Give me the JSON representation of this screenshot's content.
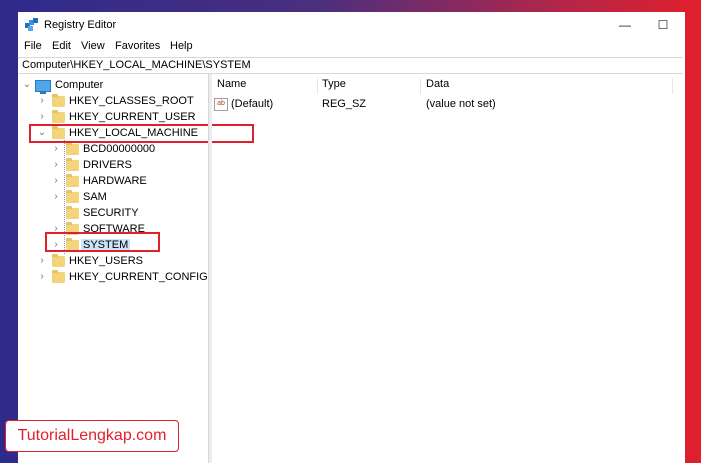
{
  "window": {
    "title": "Registry Editor",
    "minimize_glyph": "—",
    "maximize_glyph": "☐"
  },
  "menu": [
    "File",
    "Edit",
    "View",
    "Favorites",
    "Help"
  ],
  "address": "Computer\\HKEY_LOCAL_MACHINE\\SYSTEM",
  "tree": {
    "root": "Computer",
    "hives": [
      "HKEY_CLASSES_ROOT",
      "HKEY_CURRENT_USER",
      "HKEY_LOCAL_MACHINE",
      "HKEY_USERS",
      "HKEY_CURRENT_CONFIG"
    ],
    "hklm_children": [
      "BCD00000000",
      "DRIVERS",
      "HARDWARE",
      "SAM",
      "SECURITY",
      "SOFTWARE",
      "SYSTEM"
    ],
    "selected": "SYSTEM",
    "expanded": "HKEY_LOCAL_MACHINE"
  },
  "list": {
    "columns": [
      "Name",
      "Type",
      "Data"
    ],
    "rows": [
      {
        "name": "(Default)",
        "type": "REG_SZ",
        "data": "(value not set)"
      }
    ],
    "value_icon_label": "ab"
  },
  "icons": {
    "app": "registry-editor-icon",
    "folder": "folder-icon",
    "computer": "computer-icon",
    "value": "string-value-icon"
  },
  "colors": {
    "highlight": "#e0202c",
    "selection": "#cce4f7",
    "folder": "#f2d47a"
  },
  "watermark": "TutorialLengkap.com"
}
